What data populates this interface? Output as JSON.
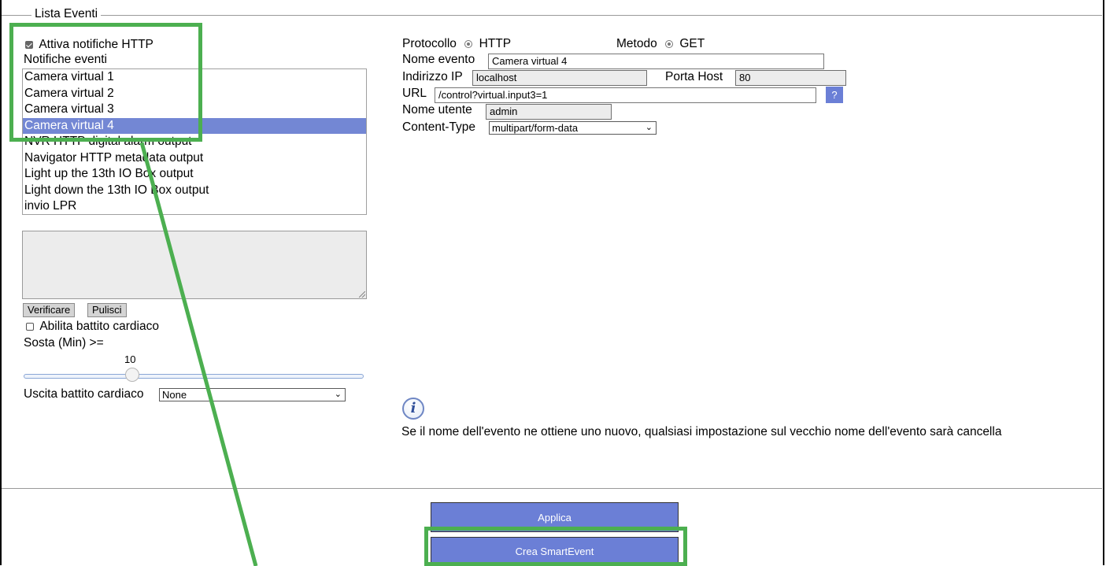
{
  "section": {
    "legend": "Lista Eventi"
  },
  "left": {
    "enable_http_label": "Attiva notifiche HTTP",
    "enable_http_checked": true,
    "events_label": "Notifiche eventi",
    "events": [
      "Camera virtual 1",
      "Camera virtual 2",
      "Camera virtual 3",
      "Camera virtual 4",
      "NVR HTTP digital alarm output",
      "Navigator HTTP metadata output",
      "Light up the 13th IO Box output",
      "Light down the 13th IO Box output",
      "invio LPR"
    ],
    "selected_event": "Camera virtual 4",
    "textarea_value": "",
    "verify_label": "Verificare",
    "clear_label": "Pulisci",
    "heartbeat_label": "Abilita battito cardiaco",
    "heartbeat_checked": false,
    "pause_label": "Sosta (Min) >=",
    "pause_value": "10",
    "pause_slider_fraction": 0.32,
    "heartbeat_output_label": "Uscita battito cardiaco",
    "heartbeat_output_value": "None"
  },
  "right": {
    "protocol_label": "Protocollo",
    "protocol_value": "HTTP",
    "method_label": "Metodo",
    "method_value": "GET",
    "event_name_label": "Nome evento",
    "event_name_value": "Camera virtual 4",
    "ip_label": "Indirizzo IP",
    "ip_value": "localhost",
    "port_label": "Porta Host",
    "port_value": "80",
    "url_label": "URL",
    "url_value": "/control?virtual.input3=1",
    "help_label": "?",
    "username_label": "Nome utente",
    "username_value": "admin",
    "content_type_label": "Content-Type",
    "content_type_value": "multipart/form-data",
    "info_icon": "info-icon",
    "info_text": "Se il nome dell'evento ne ottiene uno nuovo, qualsiasi impostazione sul vecchio nome dell'evento sarà cancella"
  },
  "footer": {
    "apply_label": "Applica",
    "create_smartevent_label": "Crea SmartEvent"
  },
  "colors": {
    "accent_blue": "#6b7fd6",
    "selected_row": "#7387d4",
    "annotation_green": "#4caf50"
  }
}
